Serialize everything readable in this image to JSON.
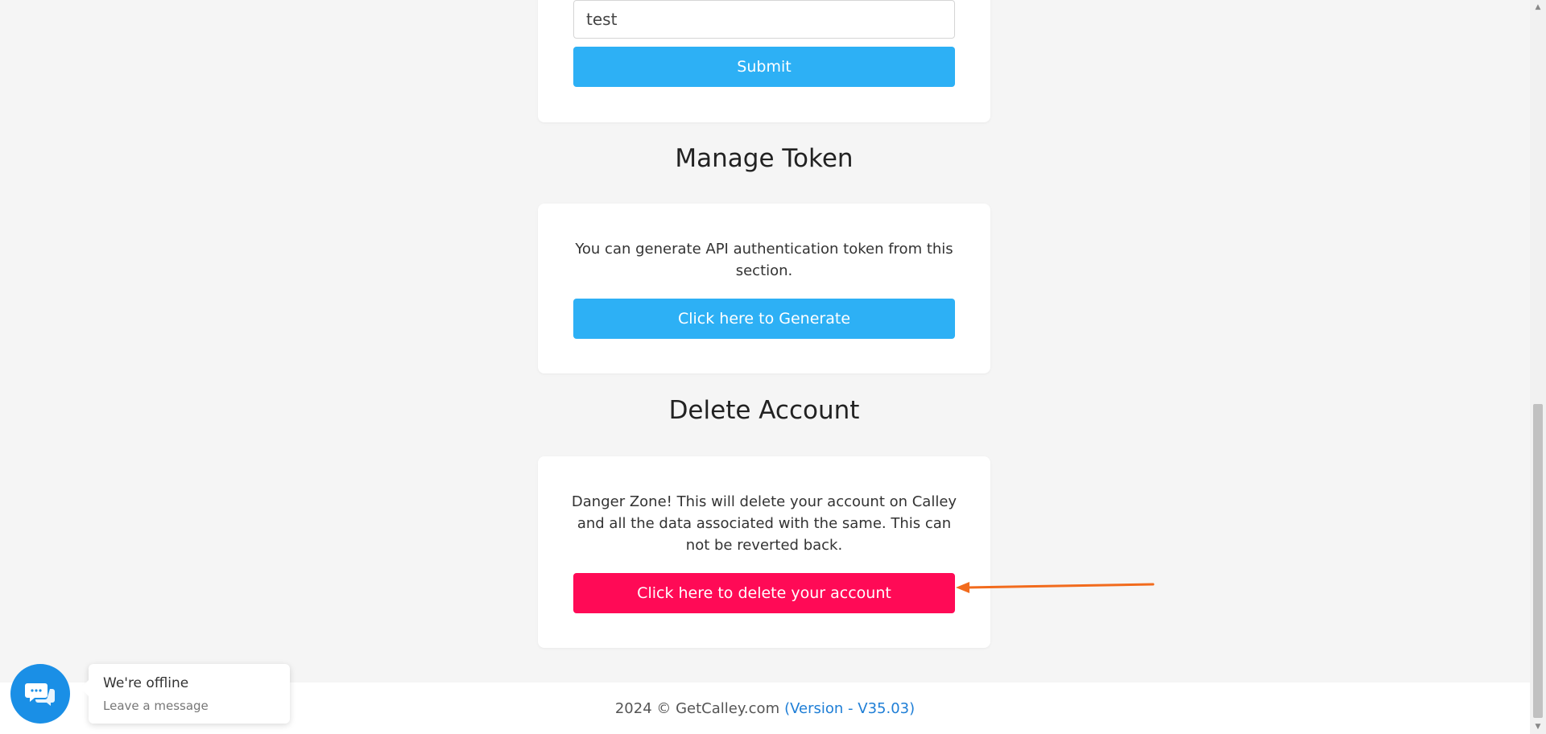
{
  "form": {
    "input_value": "test",
    "submit_label": "Submit"
  },
  "token_section": {
    "title": "Manage Token",
    "description": "You can generate API authentication token from this section.",
    "generate_label": "Click here to Generate"
  },
  "delete_section": {
    "title": "Delete Account",
    "description": "Danger Zone! This will delete your account on Calley and all the data associated with the same. This can not be reverted back.",
    "delete_label": "Click here to delete your account"
  },
  "footer": {
    "copyright": "2024 © GetCalley.com",
    "version": "(Version - V35.03)"
  },
  "chat": {
    "status": "We're offline",
    "subtext": "Leave a message",
    "icon": "chat-icon"
  },
  "colors": {
    "primary_button": "#2db0f5",
    "danger_button": "#ff0a56",
    "annotation_arrow": "#f26b1d",
    "chat_bubble": "#1a8fe6",
    "version_link": "#1e7ed6"
  }
}
